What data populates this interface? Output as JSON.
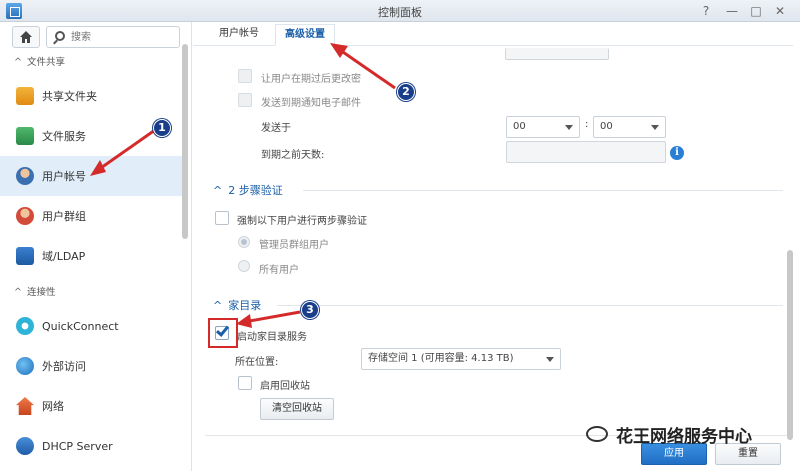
{
  "window": {
    "title": "控制面板",
    "help_glyph": "?",
    "minimize_glyph": "—",
    "maximize_glyph": "□",
    "close_glyph": "✕"
  },
  "sidebar": {
    "search_placeholder": "搜索",
    "sections": [
      {
        "label": "文件共享",
        "items": [
          {
            "label": "共享文件夹",
            "icon": "folder-share-icon"
          },
          {
            "label": "文件服务",
            "icon": "file-services-icon"
          },
          {
            "label": "用户帐号",
            "icon": "user-icon"
          },
          {
            "label": "用户群组",
            "icon": "group-icon"
          },
          {
            "label": "域/LDAP",
            "icon": "domain-ldap-icon"
          }
        ]
      },
      {
        "label": "连接性",
        "items": [
          {
            "label": "QuickConnect",
            "icon": "quickconnect-icon"
          },
          {
            "label": "外部访问",
            "icon": "globe-icon"
          },
          {
            "label": "网络",
            "icon": "network-icon"
          },
          {
            "label": "DHCP Server",
            "icon": "dhcp-icon"
          }
        ]
      }
    ]
  },
  "tabs": [
    {
      "label": "用户帐号"
    },
    {
      "label": "高级设置"
    }
  ],
  "password_expiry": {
    "allow_change_label": "让用户在期过后更改密",
    "send_email_label": "发送到期通知电子邮件",
    "send_at_label": "发送于",
    "hour_value": "00",
    "minute_value": "00",
    "time_separator": ":",
    "days_before_label": "到期之前天数:"
  },
  "two_step": {
    "title": "2 步骤验证",
    "enforce_label": "强制以下用户进行两步骤验证",
    "opt_admins": "管理员群组用户",
    "opt_all": "所有用户"
  },
  "home": {
    "title": "家目录",
    "enable_label": "启动家目录服务",
    "location_label": "所在位置:",
    "location_value": "存储空间 1 (可用容量: 4.13 TB)",
    "recycle_label": "启用回收站",
    "empty_recycle_button": "清空回收站"
  },
  "footer": {
    "apply": "应用",
    "reset": "重置"
  },
  "annotations": {
    "step1": "1",
    "step2": "2",
    "step3": "3"
  },
  "watermark": "花王网络服务中心",
  "colors": {
    "accent": "#1a5fa8",
    "annotation_red": "#d42a2a",
    "badge_blue": "#1a3f8a"
  }
}
